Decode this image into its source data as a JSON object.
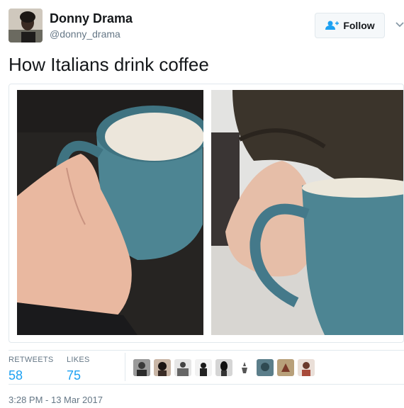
{
  "author": {
    "name": "Donny Drama",
    "handle": "@donny_drama"
  },
  "follow_button": {
    "label": "Follow",
    "icon": "add-user-icon"
  },
  "tweet": {
    "text": "How Italians drink coffee"
  },
  "stats": {
    "retweets_label": "RETWEETS",
    "retweets_value": "58",
    "likes_label": "LIKES",
    "likes_value": "75"
  },
  "timestamp": "3:28 PM - 13 Mar 2017",
  "colors": {
    "accent": "#1da1f2",
    "secondary_text": "#657786",
    "border": "#e1e8ed",
    "mug": "#4d8593"
  }
}
